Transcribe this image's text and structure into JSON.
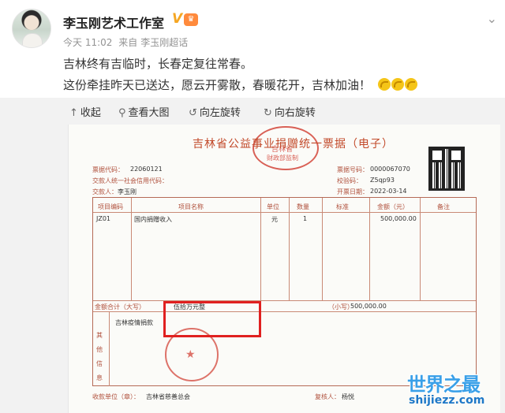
{
  "post": {
    "author": "李玉刚艺术工作室",
    "badge_v": "V",
    "level": "♛",
    "time": "今天 11:02",
    "source_prefix": "来自",
    "source": "李玉刚超话",
    "line1": "吉林终有吉临时，长春定复往常春。",
    "line2": "这份牵挂昨天已送达，愿云开雾散，春暖花开，吉林加油！",
    "more_icon": "chevron-down-icon"
  },
  "toolbar": {
    "collapse": "收起",
    "view_large": "查看大图",
    "rotate_left": "向左旋转",
    "rotate_right": "向右旋转"
  },
  "receipt": {
    "title": "吉林省公益事业捐赠统一票据（电子）",
    "seal_top_1": "吉林省",
    "seal_top_2": "财政部监制",
    "code_label": "票据代码：",
    "code_value": "22060121",
    "payer_credit_label": "交款人统一社会信用代码：",
    "payer_label": "交款人：",
    "payer_value": "李玉刚",
    "number_label": "票据号码：",
    "number_value": "0000067070",
    "check_label": "校验码：",
    "check_value": "Z5qp93",
    "date_label": "开票日期：",
    "date_value": "2022-03-14",
    "columns": [
      "项目编码",
      "项目名称",
      "单位",
      "数量",
      "标准",
      "金额（元）",
      "备注"
    ],
    "row": {
      "code": "JZ01",
      "name": "国内捐赠收入",
      "unit": "元",
      "qty": "1",
      "standard": "",
      "amount": "500,000.00",
      "note": ""
    },
    "total_label": "金额合计（大写）",
    "total_upper": "伍拾万元整",
    "total_lower_label": "（小写）",
    "total_lower": "500,000.00",
    "other_label": "其他信息",
    "other_value": "吉林疫情捐款",
    "seal_bottom": "★",
    "receiver_label": "收款单位（章）：",
    "receiver_value": "吉林省慈善总会",
    "reviewer_label": "复核人：",
    "reviewer_value": "杨悦"
  },
  "watermark": {
    "main": "世界之最",
    "sub": "shijiezz.com"
  }
}
